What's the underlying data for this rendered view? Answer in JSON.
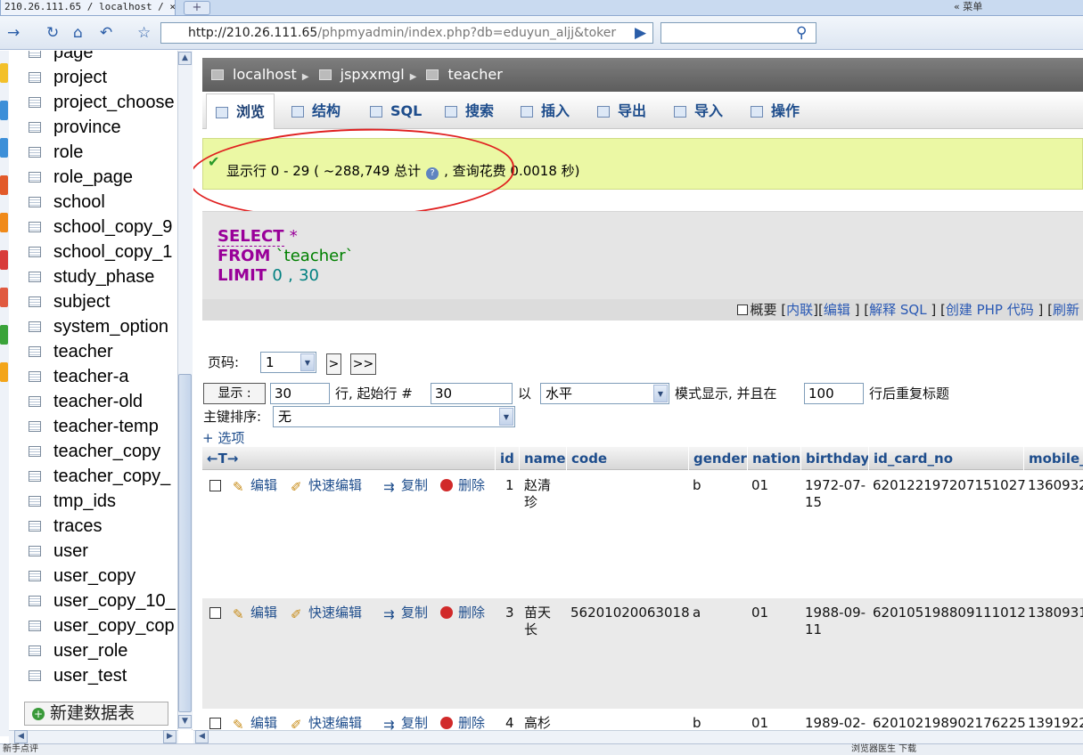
{
  "browser": {
    "tab_title": "210.26.111.65 / localhost / ×",
    "new_tab": "+",
    "menu": "« 菜单",
    "url_host": "http://210.26.111.65",
    "url_path": "/phpmyadmin/index.php?db=eduyun_aljj&toker",
    "status_left": "新手点评",
    "status_right": "浏览器医生   下载"
  },
  "sidebar": {
    "items": [
      "page",
      "project",
      "project_choose",
      "province",
      "role",
      "role_page",
      "school",
      "school_copy_9",
      "school_copy_1",
      "study_phase",
      "subject",
      "system_option",
      "teacher",
      "teacher-a",
      "teacher-old",
      "teacher-temp",
      "teacher_copy",
      "teacher_copy_",
      "tmp_ids",
      "traces",
      "user",
      "user_copy",
      "user_copy_10_",
      "user_copy_cop",
      "user_role",
      "user_test"
    ],
    "new_table": "新建数据表"
  },
  "breadcrumb": {
    "server": "localhost",
    "db": "jspxxmgl",
    "table": "teacher"
  },
  "tabs": [
    {
      "label": "浏览",
      "icon": "browse-icon"
    },
    {
      "label": "结构",
      "icon": "structure-icon"
    },
    {
      "label": "SQL",
      "icon": "sql-icon"
    },
    {
      "label": "搜索",
      "icon": "search-icon"
    },
    {
      "label": "插入",
      "icon": "insert-icon"
    },
    {
      "label": "导出",
      "icon": "export-icon"
    },
    {
      "label": "导入",
      "icon": "import-icon"
    },
    {
      "label": "操作",
      "icon": "operations-icon"
    }
  ],
  "result": {
    "prefix": "显示行  0 - 29 ( ~288,749 总计",
    "suffix": ", 查询花费  0.0018 秒)"
  },
  "sql": {
    "select": "SELECT",
    "star": "*",
    "from": "FROM",
    "table": "`teacher`",
    "limit": "LIMIT",
    "start": "0",
    "comma": ",",
    "count": "30"
  },
  "sqlbar": {
    "profiling": "概要",
    "inline": "内联",
    "edit": "编辑",
    "explain": "解释 SQL",
    "php": "创建 PHP 代码",
    "refresh": "刷新"
  },
  "paging": {
    "page_label": "页码:",
    "page_value": "1",
    "next": ">",
    "last": ">>"
  },
  "display": {
    "show_button": "显示 :",
    "rows": "30",
    "start_label": "行, 起始行 #",
    "start": "30",
    "mode_label": "以",
    "mode": "水平",
    "mode_suffix": "模式显示, 并且在",
    "repeat": "100",
    "repeat_suffix": "行后重复标题",
    "sort_label": "主键排序:",
    "sort_value": "无",
    "options": "+ 选项"
  },
  "table": {
    "arrows": "←T→",
    "columns": [
      "id",
      "name",
      "code",
      "gender",
      "nation",
      "birthday",
      "id_card_no",
      "mobile_"
    ],
    "actions": {
      "edit": "编辑",
      "quick_edit": "快速编辑",
      "copy": "复制",
      "delete": "删除"
    },
    "rows": [
      {
        "id": "1",
        "name": "赵清珍",
        "code": "",
        "gender": "b",
        "nation": "01",
        "birthday": "1972-07-15",
        "id_card_no": "620122197207151027",
        "mobile": "1360932"
      },
      {
        "id": "3",
        "name": "苗天长",
        "code": "56201020063018",
        "gender": "a",
        "nation": "01",
        "birthday": "1988-09-11",
        "id_card_no": "620105198809111012",
        "mobile": "1380931"
      },
      {
        "id": "4",
        "name": "高杉",
        "code": "",
        "gender": "b",
        "nation": "01",
        "birthday": "1989-02-",
        "id_card_no": "620102198902176225",
        "mobile": "1391922"
      }
    ]
  },
  "colors": {
    "accent": "#1e4d8c",
    "success_bg": "#ebf8a4",
    "annotation": "#e02020"
  }
}
